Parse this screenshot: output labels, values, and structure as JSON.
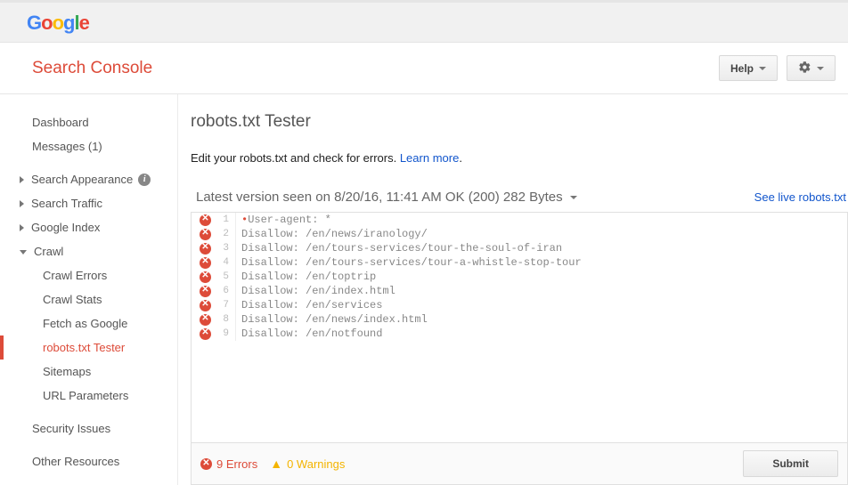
{
  "header": {
    "app_title": "Search Console",
    "help_label": "Help"
  },
  "sidebar": {
    "dashboard": "Dashboard",
    "messages": "Messages (1)",
    "search_appearance": "Search Appearance",
    "search_traffic": "Search Traffic",
    "google_index": "Google Index",
    "crawl": "Crawl",
    "crawl_children": {
      "crawl_errors": "Crawl Errors",
      "crawl_stats": "Crawl Stats",
      "fetch_as_google": "Fetch as Google",
      "robots_tester": "robots.txt Tester",
      "sitemaps": "Sitemaps",
      "url_parameters": "URL Parameters"
    },
    "security_issues": "Security Issues",
    "other_resources": "Other Resources"
  },
  "main": {
    "title": "robots.txt Tester",
    "desc_prefix": "Edit your robots.txt and check for errors. ",
    "learn_more": "Learn more",
    "desc_suffix": ".",
    "version_label": "Latest version seen on 8/20/16, 11:41 AM OK (200) 282 Bytes",
    "live_link": "See live robots.txt",
    "lines": [
      {
        "n": 1,
        "error": true,
        "dot": true,
        "text": "User-agent: *"
      },
      {
        "n": 2,
        "error": true,
        "dot": false,
        "text": "Disallow: /en/news/iranology/"
      },
      {
        "n": 3,
        "error": true,
        "dot": false,
        "text": "Disallow: /en/tours-services/tour-the-soul-of-iran"
      },
      {
        "n": 4,
        "error": true,
        "dot": false,
        "text": "Disallow: /en/tours-services/tour-a-whistle-stop-tour"
      },
      {
        "n": 5,
        "error": true,
        "dot": false,
        "text": "Disallow: /en/toptrip"
      },
      {
        "n": 6,
        "error": true,
        "dot": false,
        "text": "Disallow: /en/index.html"
      },
      {
        "n": 7,
        "error": true,
        "dot": false,
        "text": "Disallow: /en/services"
      },
      {
        "n": 8,
        "error": true,
        "dot": false,
        "text": "Disallow: /en/news/index.html"
      },
      {
        "n": 9,
        "error": true,
        "dot": false,
        "text": "Disallow: /en/notfound"
      }
    ],
    "status": {
      "errors": "9 Errors",
      "warnings": "0 Warnings",
      "submit": "Submit"
    }
  }
}
